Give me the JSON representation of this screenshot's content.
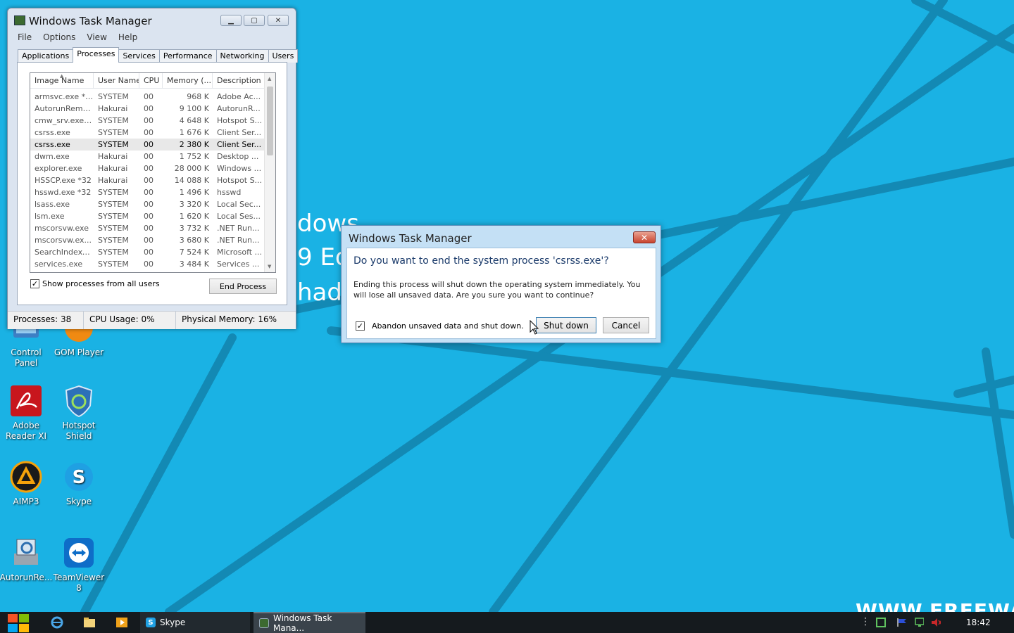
{
  "desktop": {
    "wallpaper_partial_text": [
      "dows",
      "9 Ed",
      "had"
    ],
    "watermark": "WWW.FREEWARESY",
    "icons": [
      {
        "label": "Control\nPanel"
      },
      {
        "label": "GOM Player"
      },
      {
        "label": "Adobe\nReader XI"
      },
      {
        "label": "Hotspot\nShield"
      },
      {
        "label": "AIMP3"
      },
      {
        "label": "Skype"
      },
      {
        "label": "AutorunRe..."
      },
      {
        "label": "TeamViewer\n8"
      }
    ]
  },
  "task_manager": {
    "title": "Windows Task Manager",
    "menu": [
      "File",
      "Options",
      "View",
      "Help"
    ],
    "tabs": [
      "Applications",
      "Processes",
      "Services",
      "Performance",
      "Networking",
      "Users"
    ],
    "active_tab": "Processes",
    "columns": [
      "Image Name",
      "User Name",
      "CPU",
      "Memory (...",
      "Description"
    ],
    "rows": [
      [
        "armsvc.exe *32",
        "SYSTEM",
        "00",
        "968 K",
        "Adobe Ac..."
      ],
      [
        "AutorunRemo...",
        "Hakurai",
        "00",
        "9 100 K",
        "AutorunR..."
      ],
      [
        "cmw_srv.exe ...",
        "SYSTEM",
        "00",
        "4 648 K",
        "Hotspot S..."
      ],
      [
        "csrss.exe",
        "SYSTEM",
        "00",
        "1 676 K",
        "Client Ser..."
      ],
      [
        "csrss.exe",
        "SYSTEM",
        "00",
        "2 380 K",
        "Client Ser..."
      ],
      [
        "dwm.exe",
        "Hakurai",
        "00",
        "1 752 K",
        "Desktop ..."
      ],
      [
        "explorer.exe",
        "Hakurai",
        "00",
        "28 000 K",
        "Windows ..."
      ],
      [
        "HSSCP.exe *32",
        "Hakurai",
        "00",
        "14 088 K",
        "Hotspot S..."
      ],
      [
        "hsswd.exe *32",
        "SYSTEM",
        "00",
        "1 496 K",
        "hsswd"
      ],
      [
        "lsass.exe",
        "SYSTEM",
        "00",
        "3 320 K",
        "Local Sec..."
      ],
      [
        "lsm.exe",
        "SYSTEM",
        "00",
        "1 620 K",
        "Local Ses..."
      ],
      [
        "mscorsvw.exe",
        "SYSTEM",
        "00",
        "3 732 K",
        ".NET Run..."
      ],
      [
        "mscorsvw.ex...",
        "SYSTEM",
        "00",
        "3 680 K",
        ".NET Run..."
      ],
      [
        "SearchIndexe...",
        "SYSTEM",
        "00",
        "7 524 K",
        "Microsoft ..."
      ],
      [
        "services.exe",
        "SYSTEM",
        "00",
        "3 484 K",
        "Services ..."
      ]
    ],
    "selected_row": 4,
    "show_all_label": "Show processes from all users",
    "show_all_checked": true,
    "end_process_label": "End Process",
    "status": {
      "processes": "Processes: 38",
      "cpu": "CPU Usage: 0%",
      "memory": "Physical Memory: 16%"
    }
  },
  "dialog": {
    "title": "Windows Task Manager",
    "close_symbol": "✕",
    "question": "Do you want to end the system process 'csrss.exe'?",
    "info": "Ending this process will shut down the operating system immediately.  You will lose all unsaved data.  Are you sure you want to continue?",
    "abandon_label": "Abandon unsaved data and shut down.",
    "abandon_checked": true,
    "shutdown_label": "Shut down",
    "cancel_label": "Cancel"
  },
  "taskbar": {
    "tasks": [
      {
        "label": "Skype"
      },
      {
        "label": "Windows Task Mana..."
      }
    ],
    "clock": "18:42"
  },
  "colors": {
    "desktop_bg": "#1ab2e4",
    "taskbar_bg": "#151a1e",
    "dialog_accent": "#1a3a6a"
  }
}
